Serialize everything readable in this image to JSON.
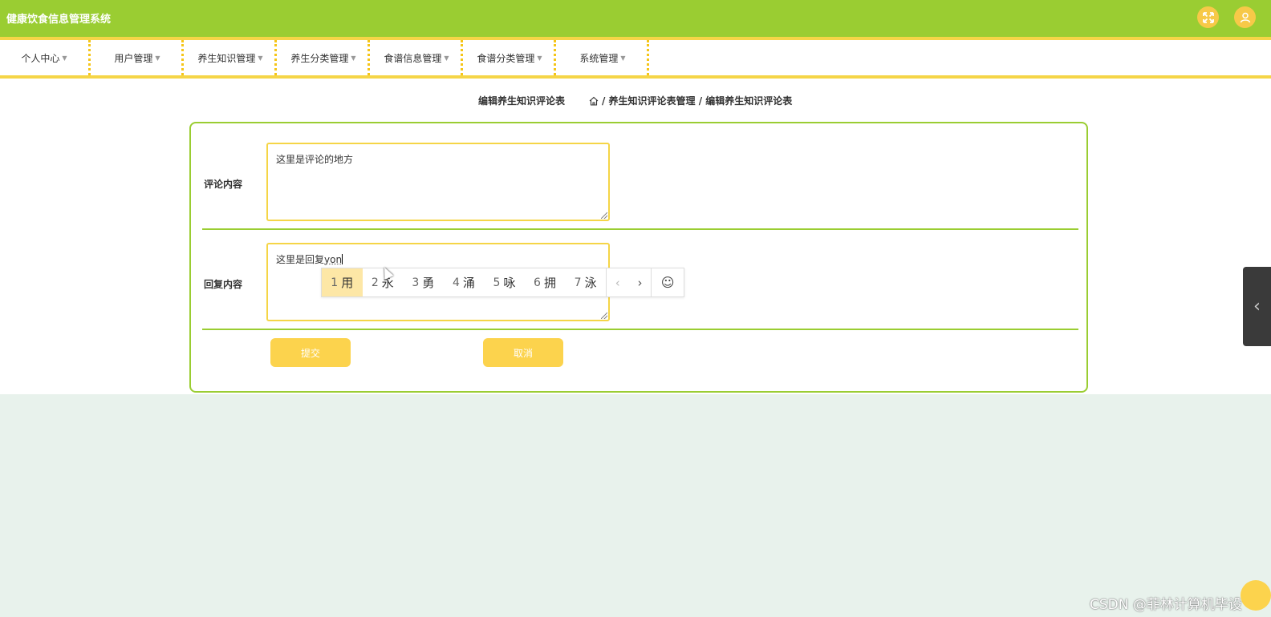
{
  "app": {
    "title": "健康饮食信息管理系统",
    "icons": [
      "fullscreen-icon",
      "user-icon"
    ]
  },
  "nav": {
    "items": [
      {
        "label": "个人中心"
      },
      {
        "label": "用户管理"
      },
      {
        "label": "养生知识管理"
      },
      {
        "label": "养生分类管理"
      },
      {
        "label": "食谱信息管理"
      },
      {
        "label": "食谱分类管理"
      },
      {
        "label": "系统管理"
      }
    ],
    "caret": "▼"
  },
  "breadcrumb": {
    "title": "编辑养生知识评论表",
    "path": "/ 养生知识评论表管理 / 编辑养生知识评论表"
  },
  "form": {
    "comment": {
      "label": "评论内容",
      "value": "这里是评论的地方"
    },
    "reply": {
      "label": "回复内容",
      "value": "这里是回复",
      "composing": "yon"
    },
    "submit_label": "提交",
    "cancel_label": "取消"
  },
  "ime": {
    "candidates": [
      {
        "num": "1",
        "char": "用"
      },
      {
        "num": "2",
        "char": "永"
      },
      {
        "num": "3",
        "char": "勇"
      },
      {
        "num": "4",
        "char": "涌"
      },
      {
        "num": "5",
        "char": "咏"
      },
      {
        "num": "6",
        "char": "拥"
      },
      {
        "num": "7",
        "char": "泳"
      }
    ],
    "prev": "‹",
    "next": "›",
    "emoji": "☺"
  },
  "side_tab": {
    "arrow": "‹"
  },
  "watermark": "CSDN @菲林计算机毕设",
  "colors": {
    "topbar": "#9acd32",
    "accent": "#f5d547",
    "button": "#fcd34d"
  }
}
